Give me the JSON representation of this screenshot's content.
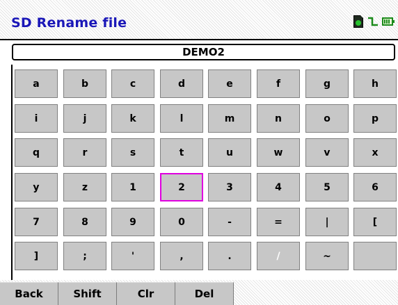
{
  "window": {
    "title": "SD Rename file",
    "status_icons": [
      "sd-card-icon",
      "signal-icon",
      "battery-icon"
    ]
  },
  "filename": {
    "value": "DEMO2"
  },
  "keyboard": {
    "selected": "2",
    "rows": [
      [
        "a",
        "b",
        "c",
        "d",
        "e",
        "f",
        "g",
        "h"
      ],
      [
        "i",
        "j",
        "k",
        "l",
        "m",
        "n",
        "o",
        "p"
      ],
      [
        "q",
        "r",
        "s",
        "t",
        "u",
        "w",
        "v",
        "x"
      ],
      [
        "y",
        "z",
        "1",
        "2",
        "3",
        "4",
        "5",
        "6"
      ],
      [
        "7",
        "8",
        "9",
        "0",
        "-",
        "=",
        "|",
        "["
      ],
      [
        "]",
        ";",
        "'",
        ",",
        ".",
        "/",
        "~",
        ""
      ]
    ]
  },
  "softkeys": [
    "Back",
    "Shift",
    "Clr",
    "Del"
  ],
  "colors": {
    "title": "#1a17b8",
    "key_face": "#c7c7c7",
    "selection": "#e000e0"
  }
}
